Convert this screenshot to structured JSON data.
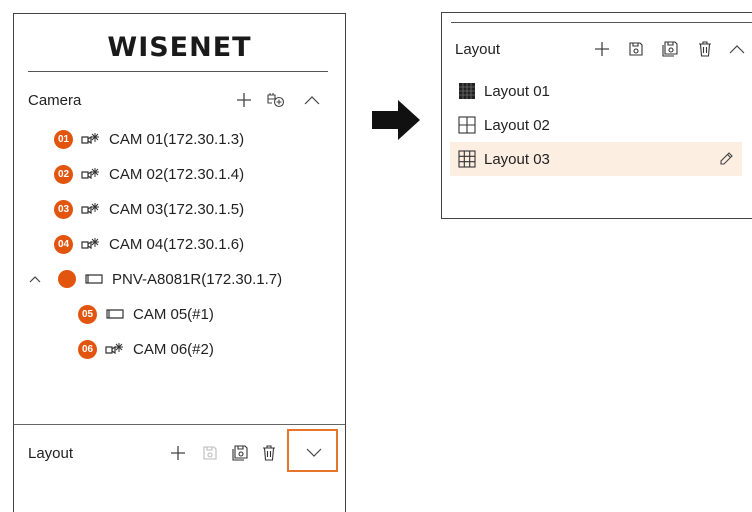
{
  "brand": {
    "logo_text": "WISENET"
  },
  "camera_section": {
    "title": "Camera",
    "icons": [
      "add-icon",
      "add-group-icon",
      "chevron-up-icon"
    ],
    "items": [
      {
        "badge": "01",
        "icon": "camera-multi-icon",
        "label": "CAM 01(172.30.1.3)"
      },
      {
        "badge": "02",
        "icon": "camera-multi-icon",
        "label": "CAM 02(172.30.1.4)"
      },
      {
        "badge": "03",
        "icon": "camera-multi-icon",
        "label": "CAM 03(172.30.1.5)"
      },
      {
        "badge": "04",
        "icon": "camera-multi-icon",
        "label": "CAM 04(172.30.1.6)"
      },
      {
        "badge": "",
        "icon": "camera-icon",
        "label": "PNV-A8081R(172.30.1.7)",
        "expanded": true
      },
      {
        "badge": "05",
        "icon": "camera-icon",
        "label": "CAM 05(#1)"
      },
      {
        "badge": "06",
        "icon": "camera-multi-icon",
        "label": "CAM 06(#2)"
      }
    ]
  },
  "layout_section": {
    "title": "Layout",
    "icons": [
      "add-icon",
      "save-icon",
      "save-as-icon",
      "delete-icon",
      "chevron-down-icon"
    ],
    "highlight": "chevron-down-icon"
  },
  "layout_panel_expanded": {
    "title": "Layout",
    "icons": [
      "add-icon",
      "save-icon",
      "save-as-icon",
      "delete-icon",
      "chevron-up-icon"
    ],
    "items": [
      {
        "label": "Layout 01",
        "icon": "grid-16-icon"
      },
      {
        "label": "Layout 02",
        "icon": "grid-4-icon"
      },
      {
        "label": "Layout 03",
        "icon": "grid-9-icon",
        "selected": true,
        "edit_icon": "pencil-icon"
      }
    ]
  },
  "colors": {
    "accent": "#e2550f",
    "highlight_border": "#e8742a",
    "selected_row": "#fdeee2"
  }
}
